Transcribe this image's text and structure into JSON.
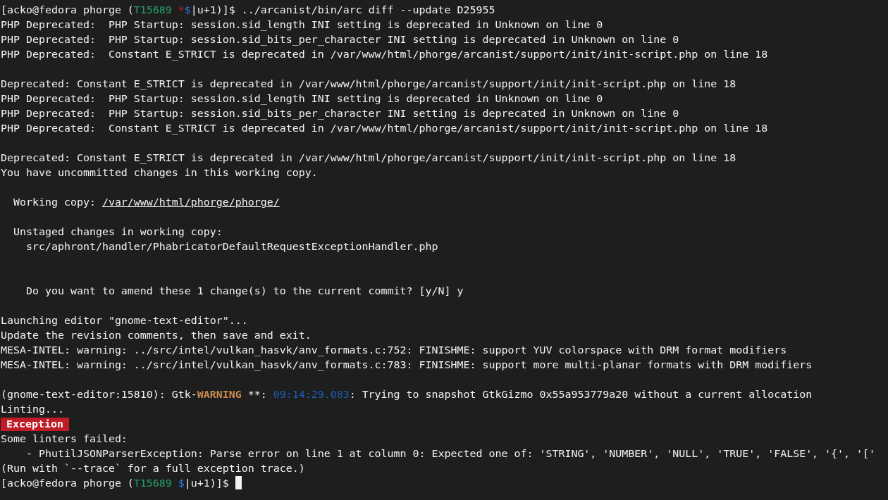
{
  "terminal": {
    "lines": [
      {
        "segments": [
          {
            "kind": "plain",
            "text": "[acko@fedora phorge ("
          },
          {
            "kind": "branch",
            "text": "T15689"
          },
          {
            "kind": "dirty",
            "text": " *"
          },
          {
            "kind": "dollar",
            "text": "$"
          },
          {
            "kind": "plain",
            "text": "|u+1)]$ ../arcanist/bin/arc diff --update D25955"
          }
        ]
      },
      {
        "segments": [
          {
            "kind": "plain",
            "text": "PHP Deprecated:  PHP Startup: session.sid_length INI setting is deprecated in Unknown on line 0"
          }
        ]
      },
      {
        "segments": [
          {
            "kind": "plain",
            "text": "PHP Deprecated:  PHP Startup: session.sid_bits_per_character INI setting is deprecated in Unknown on line 0"
          }
        ]
      },
      {
        "segments": [
          {
            "kind": "plain",
            "text": "PHP Deprecated:  Constant E_STRICT is deprecated in /var/www/html/phorge/arcanist/support/init/init-script.php on line 18"
          }
        ]
      },
      {
        "kind": "blank"
      },
      {
        "segments": [
          {
            "kind": "plain",
            "text": "Deprecated: Constant E_STRICT is deprecated in /var/www/html/phorge/arcanist/support/init/init-script.php on line 18"
          }
        ]
      },
      {
        "segments": [
          {
            "kind": "plain",
            "text": "PHP Deprecated:  PHP Startup: session.sid_length INI setting is deprecated in Unknown on line 0"
          }
        ]
      },
      {
        "segments": [
          {
            "kind": "plain",
            "text": "PHP Deprecated:  PHP Startup: session.sid_bits_per_character INI setting is deprecated in Unknown on line 0"
          }
        ]
      },
      {
        "segments": [
          {
            "kind": "plain",
            "text": "PHP Deprecated:  Constant E_STRICT is deprecated in /var/www/html/phorge/arcanist/support/init/init-script.php on line 18"
          }
        ]
      },
      {
        "kind": "blank"
      },
      {
        "segments": [
          {
            "kind": "plain",
            "text": "Deprecated: Constant E_STRICT is deprecated in /var/www/html/phorge/arcanist/support/init/init-script.php on line 18"
          }
        ]
      },
      {
        "segments": [
          {
            "kind": "plain",
            "text": "You have uncommitted changes in this working copy."
          }
        ]
      },
      {
        "kind": "blank"
      },
      {
        "segments": [
          {
            "kind": "plain",
            "text": "  Working copy: "
          },
          {
            "kind": "link",
            "text": "/var/www/html/phorge/phorge/"
          }
        ]
      },
      {
        "kind": "blank"
      },
      {
        "segments": [
          {
            "kind": "plain",
            "text": "  Unstaged changes in working copy:"
          }
        ]
      },
      {
        "segments": [
          {
            "kind": "plain",
            "text": "    src/aphront/handler/PhabricatorDefaultRequestExceptionHandler.php"
          }
        ]
      },
      {
        "kind": "blank"
      },
      {
        "kind": "blank"
      },
      {
        "segments": [
          {
            "kind": "plain",
            "text": "    Do you want to amend these 1 change(s) to the current commit? [y/N] y"
          }
        ]
      },
      {
        "kind": "blank"
      },
      {
        "segments": [
          {
            "kind": "plain",
            "text": "Launching editor \"gnome-text-editor\"..."
          }
        ]
      },
      {
        "segments": [
          {
            "kind": "plain",
            "text": "Update the revision comments, then save and exit."
          }
        ]
      },
      {
        "segments": [
          {
            "kind": "plain",
            "text": "MESA-INTEL: warning: ../src/intel/vulkan_hasvk/anv_formats.c:752: FINISHME: support YUV colorspace with DRM format modifiers"
          }
        ]
      },
      {
        "segments": [
          {
            "kind": "plain",
            "text": "MESA-INTEL: warning: ../src/intel/vulkan_hasvk/anv_formats.c:783: FINISHME: support more multi-planar formats with DRM modifiers"
          }
        ]
      },
      {
        "kind": "blank"
      },
      {
        "segments": [
          {
            "kind": "plain",
            "text": "(gnome-text-editor:15810): Gtk-"
          },
          {
            "kind": "warning",
            "text": "WARNING"
          },
          {
            "kind": "plain",
            "text": " **: "
          },
          {
            "kind": "time",
            "text": "09:14:29.083"
          },
          {
            "kind": "plain",
            "text": ": Trying to snapshot GtkGizmo 0x55a953779a20 without a current allocation"
          }
        ]
      },
      {
        "segments": [
          {
            "kind": "plain",
            "text": "Linting..."
          }
        ]
      },
      {
        "kind": "badge",
        "text": "Exception"
      },
      {
        "segments": [
          {
            "kind": "plain",
            "text": "Some linters failed:"
          }
        ]
      },
      {
        "segments": [
          {
            "kind": "plain",
            "text": "    - PhutilJSONParserException: Parse error on line 1 at column 0: Expected one of: 'STRING', 'NUMBER', 'NULL', 'TRUE', 'FALSE', '{', '['"
          }
        ]
      },
      {
        "segments": [
          {
            "kind": "plain",
            "text": "(Run with `--trace` for a full exception trace.)"
          }
        ]
      },
      {
        "segments": [
          {
            "kind": "plain",
            "text": "[acko@fedora phorge ("
          },
          {
            "kind": "branch",
            "text": "T15689"
          },
          {
            "kind": "dollar",
            "text": " $"
          },
          {
            "kind": "plain",
            "text": "|u+1)]$ "
          }
        ],
        "cursor": true
      }
    ]
  }
}
